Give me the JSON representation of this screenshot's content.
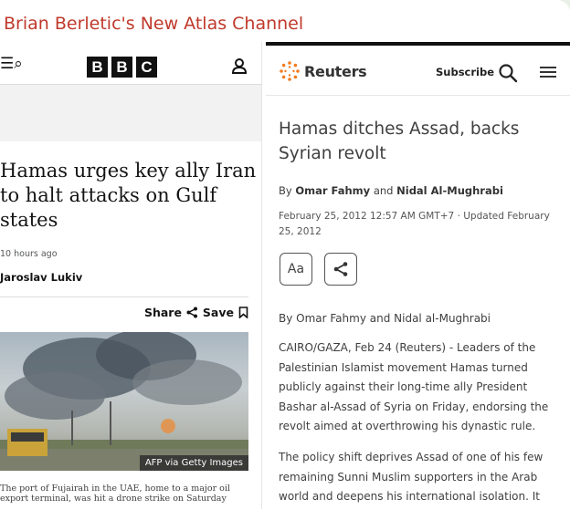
{
  "channel": {
    "title": "Brian Berletic's New Atlas Channel"
  },
  "bbc": {
    "menu_glyph": "☰⌕",
    "logo_letters": [
      "B",
      "B",
      "C"
    ],
    "headline": "Hamas urges key ally Iran to halt attacks on Gulf states",
    "timestamp": "10 hours ago",
    "author": "Jaroslav Lukiv",
    "share_label": "Share",
    "save_label": "Save",
    "photo_credit": "AFP via Getty Images",
    "caption": "The port of Fujairah in the UAE, home to a major oil export terminal, was hit a drone strike on Saturday"
  },
  "reuters": {
    "logo_text": "Reuters",
    "subscribe_label": "Subscribe",
    "headline": "Hamas ditches Assad, backs Syrian revolt",
    "byline_prefix": "By",
    "author1": "Omar Fahmy",
    "byline_and": "and",
    "author2": "Nidal Al-Mughrabi",
    "date_line": "February 25, 2012 12:57 AM GMT+7 · Updated February 25, 2012",
    "text_size_button": "Aa",
    "byline_plain": "By Omar Fahmy and Nidal al-Mughrabi",
    "paragraph1": "CAIRO/GAZA, Feb 24 (Reuters) - Leaders of the Palestinian Islamist movement Hamas turned publicly against their long-time ally President Bashar al-Assad of Syria on Friday, endorsing the revolt aimed at overthrowing his dynastic rule.",
    "paragraph2": "The policy shift deprives Assad of one of his few remaining Sunni Muslim supporters in the Arab world and deepens his international isolation. It"
  }
}
